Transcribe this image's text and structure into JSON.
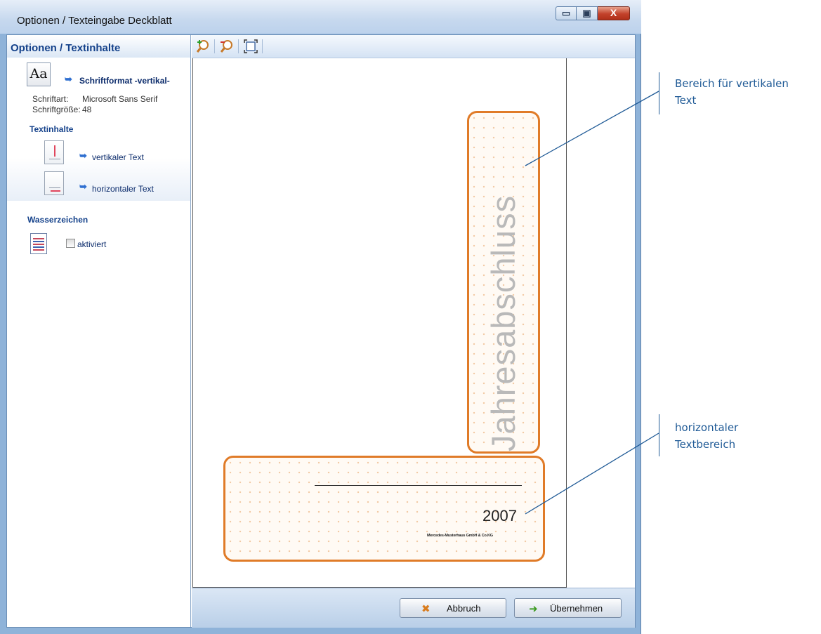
{
  "window": {
    "title": "Optionen / Texteingabe Deckblatt",
    "controls": {
      "minimize": "▭",
      "maximize": "▣",
      "close": "X"
    }
  },
  "left_panel": {
    "header": "Optionen / Textinhalte",
    "font_section": {
      "icon_text": "Aa",
      "link": "Schriftformat -vertikal-",
      "font_label": "Schriftart:",
      "font_value": "Microsoft Sans Serif",
      "size_label": "Schriftgröße:",
      "size_value": "48"
    },
    "textinhalte": {
      "title": "Textinhalte",
      "items": [
        {
          "label": "vertikaler Text",
          "icon": "vertical-text-icon"
        },
        {
          "label": "horizontaler Text",
          "icon": "horizontal-text-icon"
        }
      ]
    },
    "wasserzeichen": {
      "title": "Wasserzeichen",
      "checkbox_label": "aktiviert",
      "checked": false
    }
  },
  "toolbar": {
    "icons": [
      "zoom-in-icon",
      "zoom-out-icon",
      "fit-page-icon"
    ]
  },
  "preview": {
    "vertical_text": "Jahresabschluss",
    "year": "2007",
    "company": "Mercedes-Musterhaus GmbH & Co.KG",
    "region_color": "#e07b28"
  },
  "buttons": {
    "cancel": "Abbruch",
    "apply": "Übernehmen"
  },
  "annotations": {
    "vertical_area_line1": "Bereich für vertikalen",
    "vertical_area_line2": "Text",
    "horizontal_area_line1": "horizontaler",
    "horizontal_area_line2": "Textbereich"
  }
}
